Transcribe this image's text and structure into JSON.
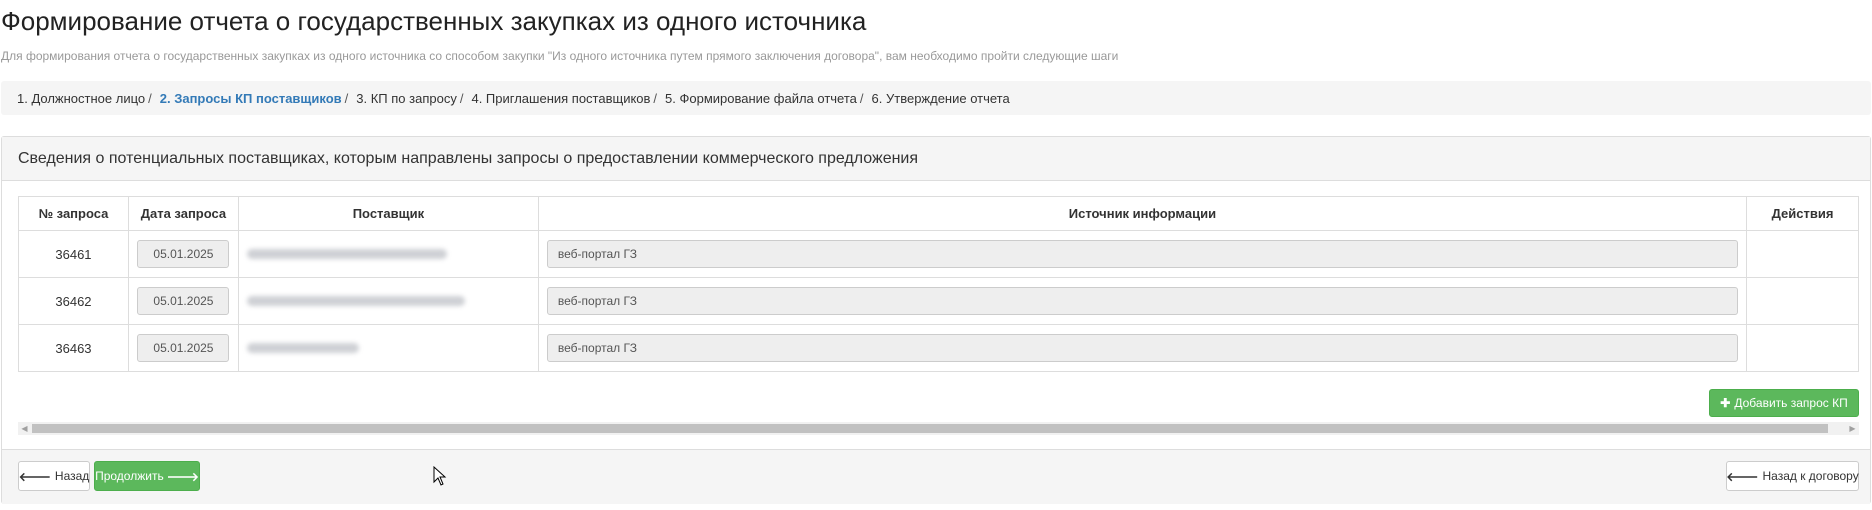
{
  "header": {
    "title": "Формирование отчета о государственных закупках из одного источника",
    "subtitle": "Для формирования отчета о государственных закупках из одного источника со способом закупки \"Из одного источника путем прямого заключения договора\", вам необходимо пройти следующие шаги"
  },
  "steps": [
    {
      "label": "1. Должностное лицо",
      "active": false
    },
    {
      "label": "2. Запросы КП поставщиков",
      "active": true
    },
    {
      "label": "3. КП по запросу",
      "active": false
    },
    {
      "label": "4. Приглашения поставщиков",
      "active": false
    },
    {
      "label": "5. Формирование файла отчета",
      "active": false
    },
    {
      "label": "6. Утверждение отчета",
      "active": false
    }
  ],
  "step_separator": "/",
  "panel": {
    "heading": "Сведения о потенциальных поставщиках, которым направлены запросы о предоставлении коммерческого предложения"
  },
  "table": {
    "columns": [
      "№ запроса",
      "Дата запроса",
      "Поставщик",
      "Источник информации",
      "Действия"
    ],
    "rows": [
      {
        "request_no": "36461",
        "date": "05.01.2025",
        "supplier": "",
        "source": "веб-портал ГЗ"
      },
      {
        "request_no": "36462",
        "date": "05.01.2025",
        "supplier": "",
        "source": "веб-портал ГЗ"
      },
      {
        "request_no": "36463",
        "date": "05.01.2025",
        "supplier": "",
        "source": "веб-портал ГЗ"
      }
    ]
  },
  "buttons": {
    "add_request": "Добавить запрос КП",
    "back": "Назад",
    "continue": "Продолжить",
    "back_to_contract": "Назад к договору"
  },
  "icons": {
    "add": "plus-icon",
    "back": "arrow-left-icon",
    "continue": "arrow-right-icon"
  },
  "colors": {
    "success": "#5cb85c",
    "link_active": "#337ab7",
    "panel_bg": "#f5f5f5"
  }
}
